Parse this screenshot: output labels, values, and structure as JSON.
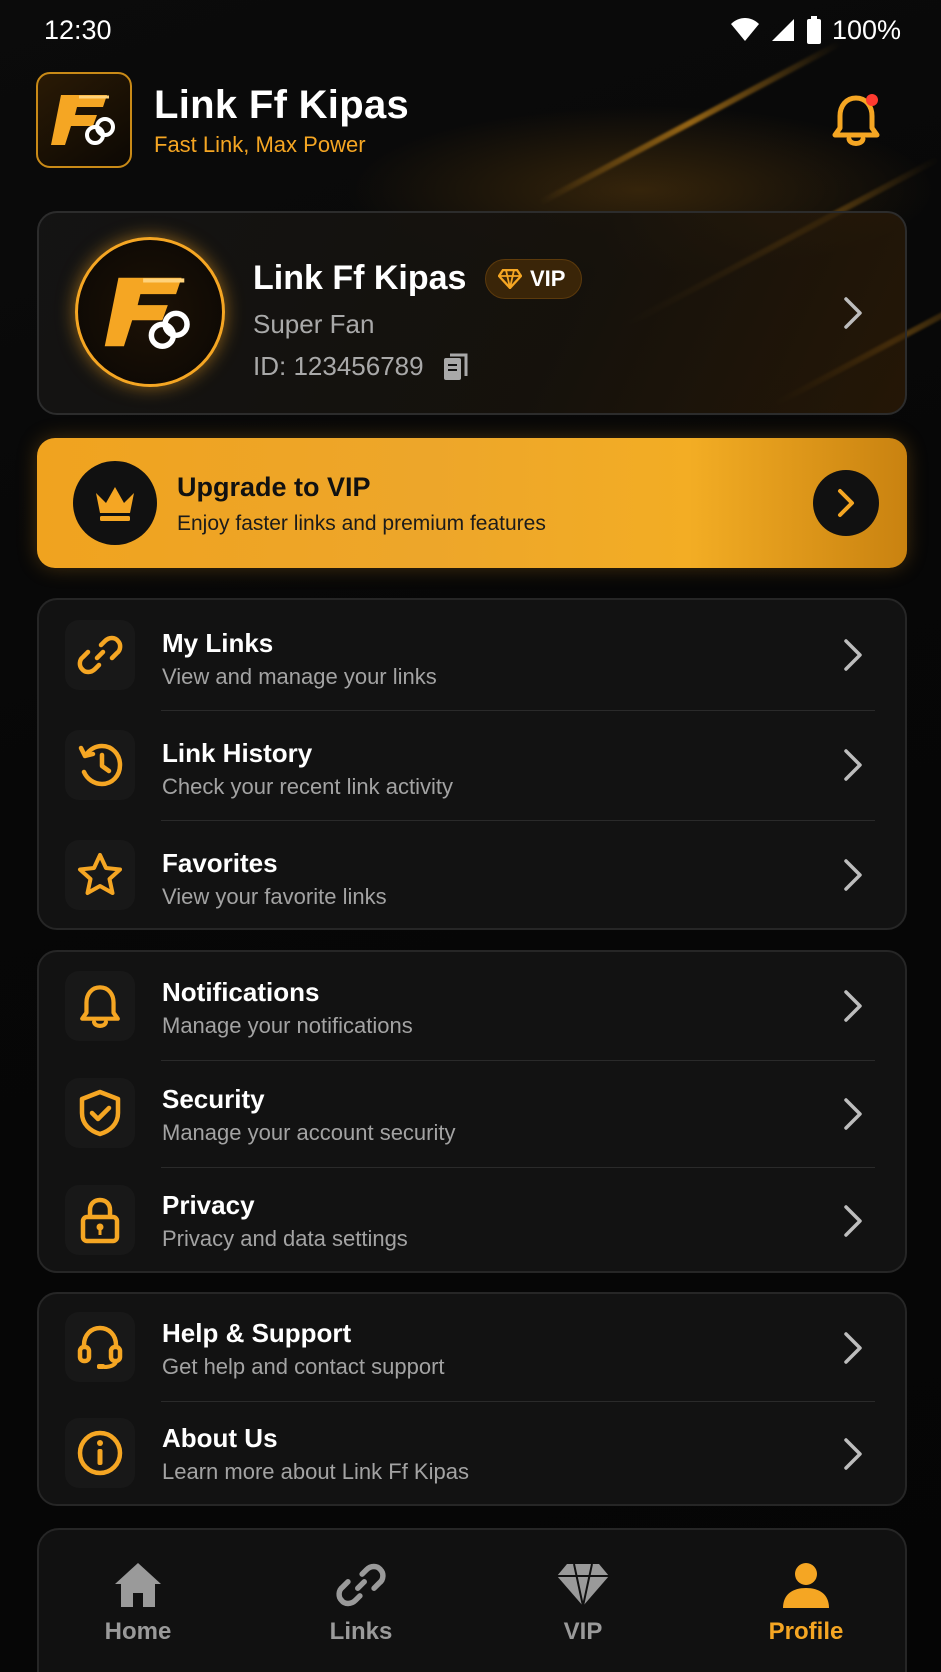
{
  "status_bar": {
    "time": "12:30",
    "battery": "100%"
  },
  "header": {
    "title": "Link Ff Kipas",
    "tagline": "Fast Link, Max Power"
  },
  "profile": {
    "name": "Link Ff Kipas",
    "badge": "VIP",
    "subtitle": "Super Fan",
    "id_text": "ID: 123456789"
  },
  "upgrade": {
    "title": "Upgrade to VIP",
    "subtitle": "Enjoy faster links and premium features"
  },
  "menu_groups": [
    {
      "items": [
        {
          "title": "My Links",
          "subtitle": "View and manage your links",
          "icon": "link-icon"
        },
        {
          "title": "Link History",
          "subtitle": "Check your recent link activity",
          "icon": "history-icon"
        },
        {
          "title": "Favorites",
          "subtitle": "View your favorite links",
          "icon": "star-icon"
        }
      ]
    },
    {
      "items": [
        {
          "title": "Notifications",
          "subtitle": "Manage your notifications",
          "icon": "bell-icon"
        },
        {
          "title": "Security",
          "subtitle": "Manage your account security",
          "icon": "shield-icon"
        },
        {
          "title": "Privacy",
          "subtitle": "Privacy and data settings",
          "icon": "lock-icon"
        }
      ]
    },
    {
      "items": [
        {
          "title": "Help & Support",
          "subtitle": "Get help and contact support",
          "icon": "headset-icon"
        },
        {
          "title": "About Us",
          "subtitle": "Learn more about Link Ff Kipas",
          "icon": "info-icon"
        }
      ]
    }
  ],
  "bottom_nav": [
    {
      "label": "Home",
      "icon": "home-icon",
      "active": false
    },
    {
      "label": "Links",
      "icon": "link-icon",
      "active": false
    },
    {
      "label": "VIP",
      "icon": "diamond-icon",
      "active": false
    },
    {
      "label": "Profile",
      "icon": "person-icon",
      "active": true
    }
  ],
  "colors": {
    "accent": "#f5a623",
    "background": "#050505",
    "card": "#121212",
    "muted_text": "#a3a3a3",
    "notification_dot": "#ff3b30"
  }
}
